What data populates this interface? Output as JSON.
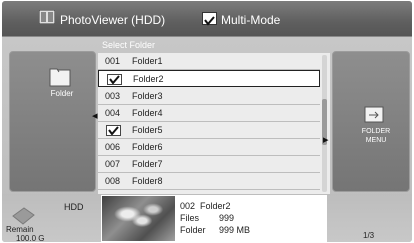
{
  "header": {
    "title": "PhotoViewer (HDD)",
    "multi_mode_label": "Multi-Mode",
    "multi_mode_checked": true
  },
  "left_panel": {
    "label": "Folder",
    "icon": "folder-icon"
  },
  "right_panel": {
    "label_line1": "FOLDER",
    "label_line2": "MENU",
    "icon": "folder-menu-icon"
  },
  "list": {
    "header": "Select Folder",
    "rows": [
      {
        "num": "001",
        "name": "Folder1",
        "checked": false,
        "selected": false
      },
      {
        "num": "",
        "name": "Folder2",
        "checked": true,
        "selected": true
      },
      {
        "num": "003",
        "name": "Folder3",
        "checked": false,
        "selected": false
      },
      {
        "num": "004",
        "name": "Folder4",
        "checked": false,
        "selected": false
      },
      {
        "num": "",
        "name": "Folder5",
        "checked": true,
        "selected": false
      },
      {
        "num": "006",
        "name": "Folder6",
        "checked": false,
        "selected": false
      },
      {
        "num": "007",
        "name": "Folder7",
        "checked": false,
        "selected": false
      },
      {
        "num": "008",
        "name": "Folder8",
        "checked": false,
        "selected": false
      }
    ]
  },
  "storage": {
    "device": "HDD",
    "remain_label": "Remain",
    "remain_value": "100.0 G"
  },
  "info": {
    "folder_id": "002",
    "folder_name": "Folder2",
    "files_label": "Files",
    "files_value": "999",
    "folder_label": "Folder",
    "folder_size": "999 MB"
  },
  "page_indicator": "1/3"
}
